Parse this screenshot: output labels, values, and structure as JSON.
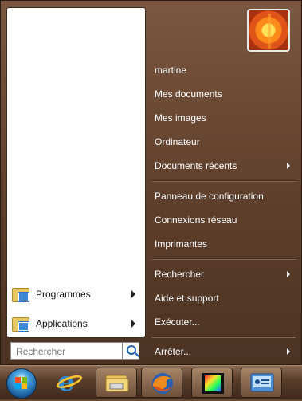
{
  "left_pane": {
    "items": [
      {
        "label": "Programmes",
        "icon": "programs-folder-icon"
      },
      {
        "label": "Applications",
        "icon": "applications-folder-icon"
      }
    ]
  },
  "search": {
    "placeholder": "Rechercher"
  },
  "right_pane": {
    "user": "martine",
    "items": [
      {
        "label": "Mes documents"
      },
      {
        "label": "Mes images"
      },
      {
        "label": "Ordinateur"
      },
      {
        "label": "Documents récents"
      },
      {
        "label": "Panneau de configuration"
      },
      {
        "label": "Connexions réseau"
      },
      {
        "label": "Imprimantes"
      },
      {
        "label": "Rechercher"
      },
      {
        "label": "Aide et support"
      },
      {
        "label": "Exécuter..."
      },
      {
        "label": "Arrêter..."
      }
    ]
  },
  "taskbar": {
    "items": [
      "start-orb",
      "internet-explorer-icon",
      "explorer-folder-icon",
      "firefox-icon",
      "media-filmstrip-icon",
      "control-panel-icon"
    ]
  },
  "colors": {
    "menu_bg": "#5e3f2b",
    "left_pane_bg": "#ffffff",
    "text_light": "#ffffff"
  }
}
